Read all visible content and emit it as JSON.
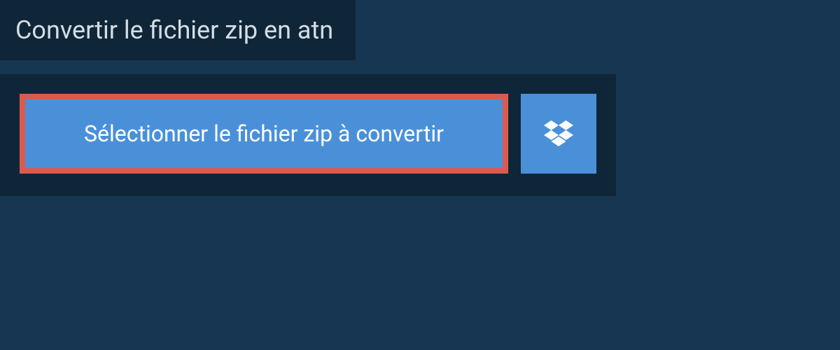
{
  "title": "Convertir le fichier zip en atn",
  "select_button_label": "Sélectionner le fichier zip à convertir",
  "colors": {
    "background": "#163652",
    "panel": "#0f2638",
    "accent": "#4a90d9",
    "highlight_border": "#db5a4f",
    "text_light": "#d5dde4",
    "text_white": "#ffffff"
  }
}
